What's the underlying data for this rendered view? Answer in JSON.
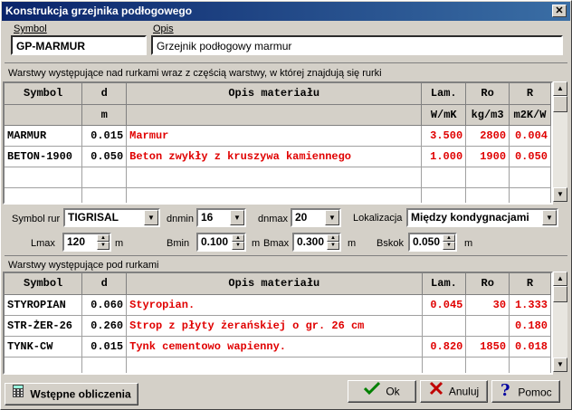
{
  "window": {
    "title": "Konstrukcja grzejnika podłogowego",
    "close": "✕"
  },
  "symbol": {
    "label": "Symbol",
    "value": "GP-MARMUR"
  },
  "opis": {
    "label": "Opis",
    "value": "Grzejnik podłogowy marmur"
  },
  "upper": {
    "title": "Warstwy występujące nad rurkami wraz z częścią warstwy, w której znajdują się rurki",
    "headers": [
      "Symbol",
      "d",
      "Opis materiału",
      "Lam.",
      "Ro",
      "R"
    ],
    "units": [
      "",
      "m",
      "",
      "W/mK",
      "kg/m3",
      "m2K/W"
    ],
    "rows": [
      [
        "MARMUR",
        "0.015",
        "Marmur",
        "3.500",
        "2800",
        "0.004"
      ],
      [
        "BETON-1900",
        "0.050",
        "Beton zwykły z kruszywa kamiennego",
        "1.000",
        "1900",
        "0.050"
      ],
      [
        "",
        "",
        "",
        "",
        "",
        ""
      ],
      [
        "",
        "",
        "",
        "",
        "",
        ""
      ]
    ]
  },
  "controls": {
    "symbol_rur_label": "Symbol rur",
    "symbol_rur": "TIGRISAL",
    "dnmin_label": "dnmin",
    "dnmin": "16",
    "dnmax_label": "dnmax",
    "dnmax": "20",
    "lokalizacja_label": "Lokalizacja",
    "lokalizacja": "Między kondygnacjami",
    "lmax_label": "Lmax",
    "lmax": "120",
    "lmax_unit": "m",
    "bmin_label": "Bmin",
    "bmin": "0.100",
    "bmin_unit": "m",
    "bmax_label": "Bmax",
    "bmax": "0.300",
    "bmax_unit": "m",
    "bskok_label": "Bskok",
    "bskok": "0.050",
    "bskok_unit": "m"
  },
  "lower": {
    "title": "Warstwy występujące pod rurkami",
    "headers": [
      "Symbol",
      "d",
      "Opis materiału",
      "Lam.",
      "Ro",
      "R"
    ],
    "rows": [
      [
        "STYROPIAN",
        "0.060",
        "Styropian.",
        "0.045",
        "30",
        "1.333"
      ],
      [
        "STR-ŻER-26",
        "0.260",
        "Strop z płyty żerańskiej o gr. 26 cm",
        "",
        "",
        "0.180"
      ],
      [
        "TYNK-CW",
        "0.015",
        "Tynk cementowo wapienny.",
        "0.820",
        "1850",
        "0.018"
      ],
      [
        "",
        "",
        "",
        "",
        "",
        ""
      ]
    ]
  },
  "buttons": {
    "wstepne": "Wstępne obliczenia",
    "ok": "Ok",
    "anuluj": "Anuluj",
    "pomoc": "Pomoc"
  }
}
